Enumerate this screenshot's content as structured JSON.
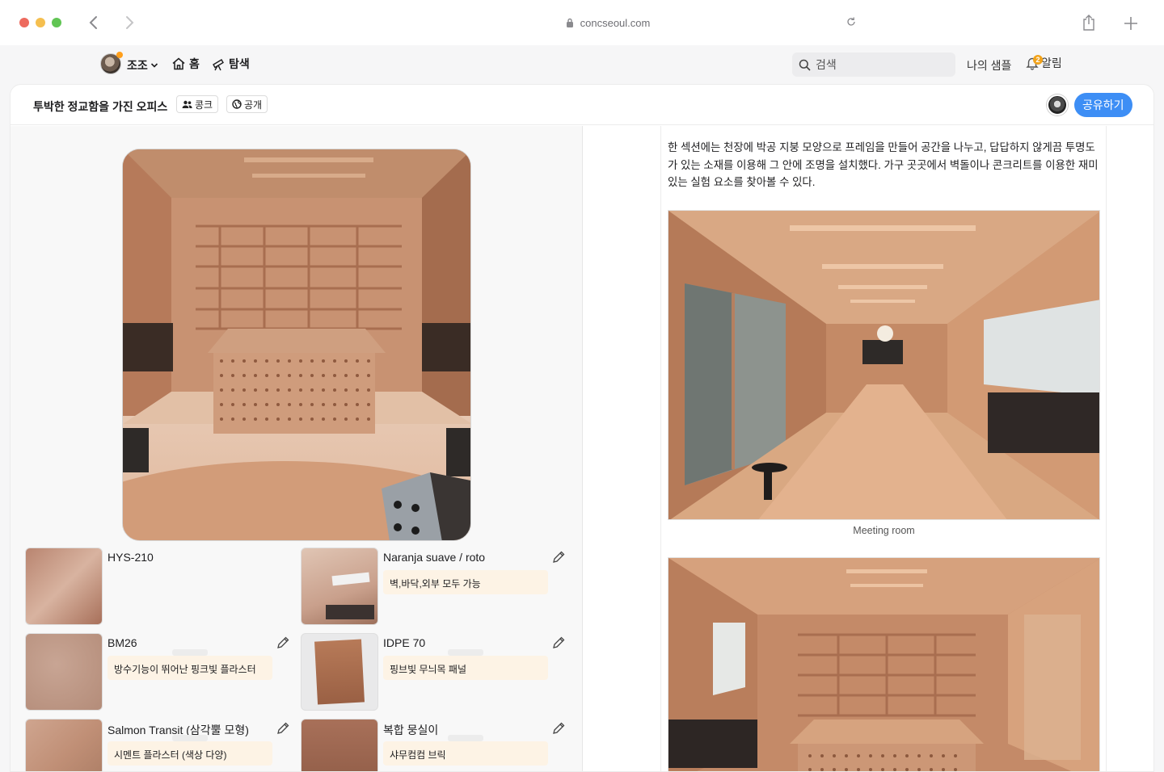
{
  "browser": {
    "url": "concseoul.com",
    "colors": {
      "close": "#ed6a5e",
      "minimize": "#f5bf4f",
      "zoom": "#61c554"
    }
  },
  "nav": {
    "user": "조조",
    "home": "홈",
    "explore": "탐색",
    "search_placeholder": "검색",
    "my_samples": "나의 샘플",
    "alarm": "알림",
    "alarm_count": "2"
  },
  "doc": {
    "title": "투박한 정교함을 가진 오피스",
    "team_chip": "콩크",
    "visibility_chip": "공개",
    "share_button": "공유하기"
  },
  "materials": [
    {
      "name": "HYS-210",
      "note": ""
    },
    {
      "name": "Naranja suave / roto",
      "note": "벽,바닥,외부 모두 가능"
    },
    {
      "name": "BM26",
      "note": "방수기능이 뛰어난 핑크빛 플라스터"
    },
    {
      "name": "IDPE 70",
      "note": "핑브빛 무늬목 패널"
    },
    {
      "name": "Salmon Transit (삼각뿔 모형)",
      "note": "시멘트 플라스터 (색상 다양)"
    },
    {
      "name": "복합 뭉실이",
      "note": "샤무컴컴 브릭"
    }
  ],
  "article": {
    "paragraph": "한 섹션에는 천장에 박공 지붕 모양으로 프레임을 만들어 공간을 나누고, 답답하지 않게끔 투명도가 있는 소재를 이용해 그 안에 조명을 설치했다. 가구 곳곳에서 벽돌이나 콘크리트를 이용한 재미있는 실험 요소를 찾아볼 수 있다.",
    "caption_1": "Meeting room"
  },
  "accent": "#3d8ef5"
}
